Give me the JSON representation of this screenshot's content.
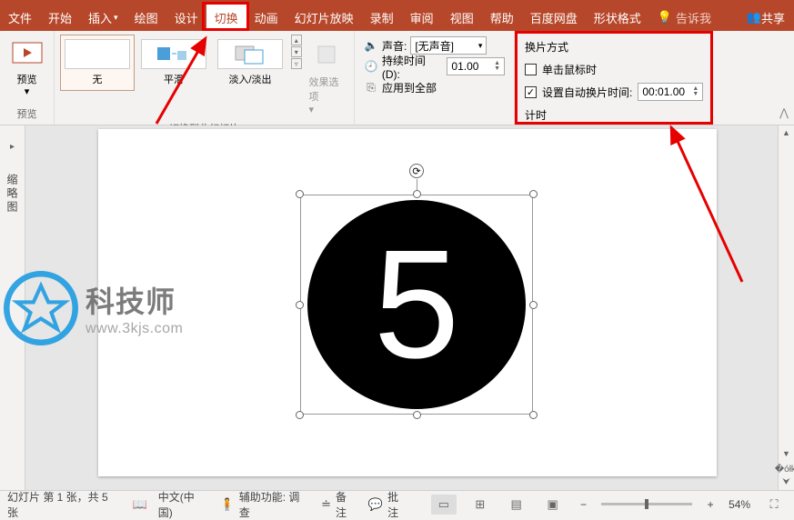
{
  "tabs": {
    "file": "文件",
    "home": "开始",
    "insert": "插入",
    "draw": "绘图",
    "design": "设计",
    "transitions": "切换",
    "animations": "动画",
    "slideshow": "幻灯片放映",
    "record": "录制",
    "review": "审阅",
    "view": "视图",
    "help": "帮助",
    "baidu": "百度网盘",
    "shape_format": "形状格式",
    "tellme": "告诉我",
    "share": "共享"
  },
  "ribbon": {
    "preview": {
      "label": "预览",
      "group": "预览"
    },
    "transitions": {
      "none": "无",
      "morph": "平滑",
      "fade": "淡入/淡出",
      "group": "切换到此幻灯片"
    },
    "effect_options": "效果选项",
    "timing": {
      "sound": "声音:",
      "sound_value": "[无声音]",
      "duration": "持续时间(D):",
      "duration_value": "01.00",
      "apply_all": "应用到全部"
    },
    "advance": {
      "title": "换片方式",
      "on_click": "单击鼠标时",
      "auto_after": "设置自动换片时间:",
      "auto_value": "00:01.00",
      "group": "计时"
    }
  },
  "thumb_label": "缩略图",
  "slide_text": "5",
  "status": {
    "slide_info": "幻灯片 第 1 张，共 5 张",
    "language": "中文(中国)",
    "accessibility": "辅助功能: 调查",
    "notes": "备注",
    "comments": "批注",
    "zoom": "54%"
  },
  "watermark": {
    "name": "科技师",
    "url": "www.3kjs.com"
  }
}
